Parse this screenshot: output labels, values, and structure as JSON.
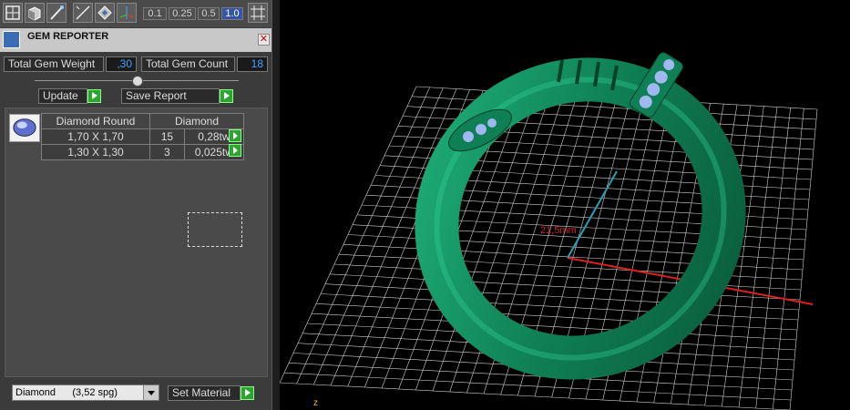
{
  "toolbar": {
    "icons": [
      "grid-view-icon",
      "cube-view-icon",
      "wand-icon",
      "measure-icon",
      "diamond-view-icon",
      "axis-icon",
      "snap-grid-icon"
    ],
    "zoom_levels": [
      "0.1",
      "0.25",
      "0.5",
      "1.0"
    ],
    "active_zoom": "1.0"
  },
  "panel": {
    "title": "GEM REPORTER",
    "total_weight_label": "Total Gem Weight",
    "total_weight_value": ",30",
    "total_count_label": "Total Gem Count",
    "total_count_value": "18",
    "update_label": "Update",
    "save_label": "Save Report"
  },
  "report": {
    "gem_name": "Diamond Round",
    "material": "Diamond",
    "rows": [
      {
        "size": "1,70 X 1,70",
        "count": "15",
        "weight": "0,28tw"
      },
      {
        "size": "1,30 X 1,30",
        "count": "3",
        "weight": "0,025tw"
      }
    ]
  },
  "footer": {
    "material_select": "Diamond      (3,52 spg)",
    "set_material_label": "Set Material"
  },
  "viewport": {
    "dimension_label": "21,5mm",
    "axis_label": "z",
    "colors": {
      "ring": "#0f8a5e",
      "grid": "#cfcfcf",
      "x_axis": "#e02020",
      "z_axis": "#2aa0b0",
      "gem": "#9fb8f0"
    }
  }
}
